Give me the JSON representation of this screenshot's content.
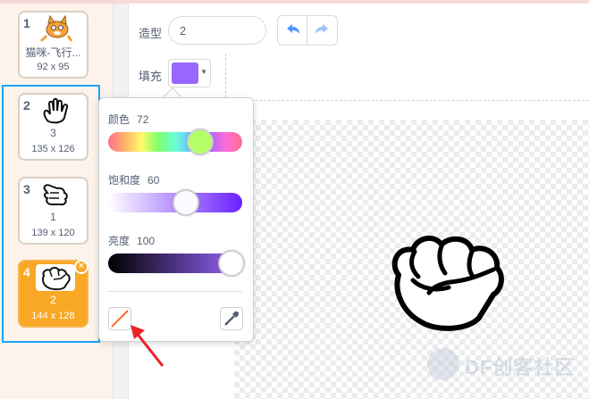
{
  "costumes": [
    {
      "num": "1",
      "name": "猫咪-飞行...",
      "size": "92 x 95",
      "thumb": "cat-flying",
      "selected": false
    },
    {
      "num": "2",
      "name": "3",
      "size": "135 x 126",
      "thumb": "open-hand",
      "selected": false
    },
    {
      "num": "3",
      "name": "1",
      "size": "139 x 120",
      "thumb": "scissors-hand",
      "selected": false
    },
    {
      "num": "4",
      "name": "2",
      "size": "144 x 128",
      "thumb": "fist",
      "selected": true
    }
  ],
  "editor": {
    "costume_label": "造型",
    "costume_name": "2",
    "fill_label": "填充",
    "fill_color": "#9966ff"
  },
  "color_picker": {
    "hue_label": "颜色",
    "hue_value": "72",
    "saturation_label": "饱和度",
    "saturation_value": "60",
    "brightness_label": "亮度",
    "brightness_value": "100"
  },
  "colors": {
    "selected_tile": "#f9a825",
    "highlight_box": "#1aa3ff",
    "undo_icon": "#4c97ff",
    "annotation_arrow": "#e8232a"
  },
  "watermark": {
    "text": "DF创客社区"
  }
}
